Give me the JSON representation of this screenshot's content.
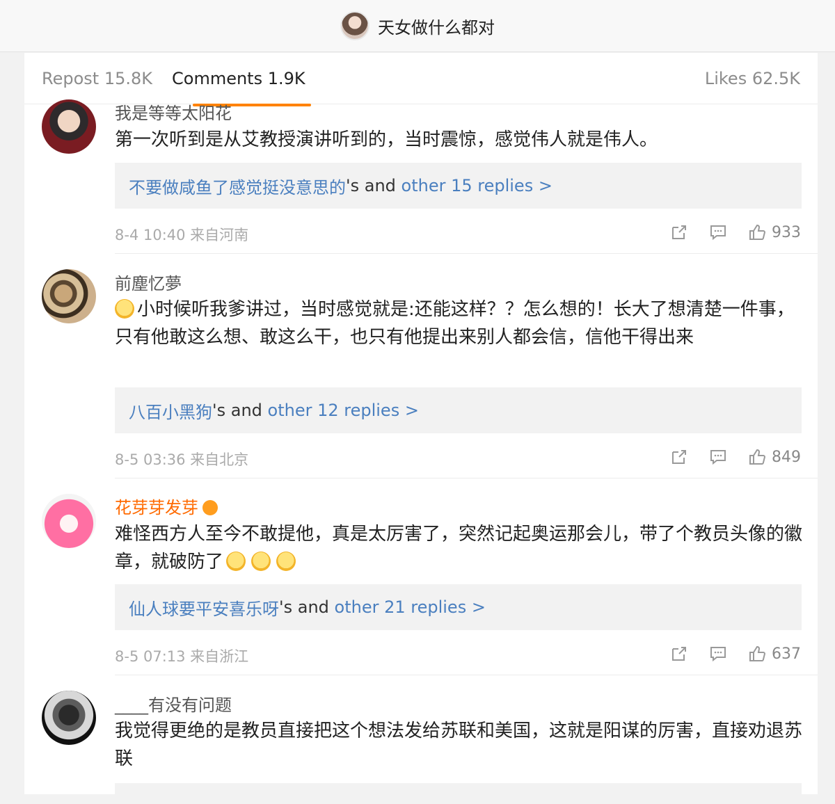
{
  "header": {
    "title": "天女做什么都对"
  },
  "tabs": [
    {
      "label": "Repost 15.8K"
    },
    {
      "label": "Comments 1.9K"
    },
    {
      "label": "Likes 62.5K"
    }
  ],
  "comments": [
    {
      "username": "我是等等太阳花",
      "text": "第一次听到是从艾教授演讲听到的，当时震惊，感觉伟人就是伟人。",
      "reply_user": "不要做咸鱼了感觉挺没意思的",
      "reply_mid": "'s and ",
      "reply_more": "other 15 replies >",
      "time": "8-4 10:40 来自河南",
      "likes": "933"
    },
    {
      "username": "前塵忆夢",
      "text": "小时候听我爹讲过，当时感觉就是:还能这样？？怎么想的！长大了想清楚一件事，只有他敢这么想、敢这么干，也只有他提出来别人都会信，信他干得出来",
      "reply_user": "八百小黑狗",
      "reply_mid": "'s and ",
      "reply_more": "other 12 replies >",
      "time": "8-5 03:36 来自北京",
      "likes": "849"
    },
    {
      "username": "花芽芽发芽",
      "text": "难怪西方人至今不敢提他，真是太厉害了，突然记起奥运那会儿，带了个教员头像的徽章，就破防了",
      "reply_user": "仙人球要平安喜乐呀",
      "reply_mid": "'s and ",
      "reply_more": "other 21 replies >",
      "time": "8-5 07:13 来自浙江",
      "likes": "637"
    },
    {
      "username": "____有没有问题",
      "text": "我觉得更绝的是教员直接把这个想法发给苏联和美国，这就是阳谋的厉害，直接劝退苏联"
    }
  ],
  "colors": {
    "accent": "#ff8200",
    "link": "#4a7fbf",
    "vip_name": "#ff6a00"
  },
  "icons": [
    "share-icon",
    "comment-icon",
    "like-icon",
    "emoji-doge",
    "emoji-smile",
    "vip-badge-icon"
  ]
}
